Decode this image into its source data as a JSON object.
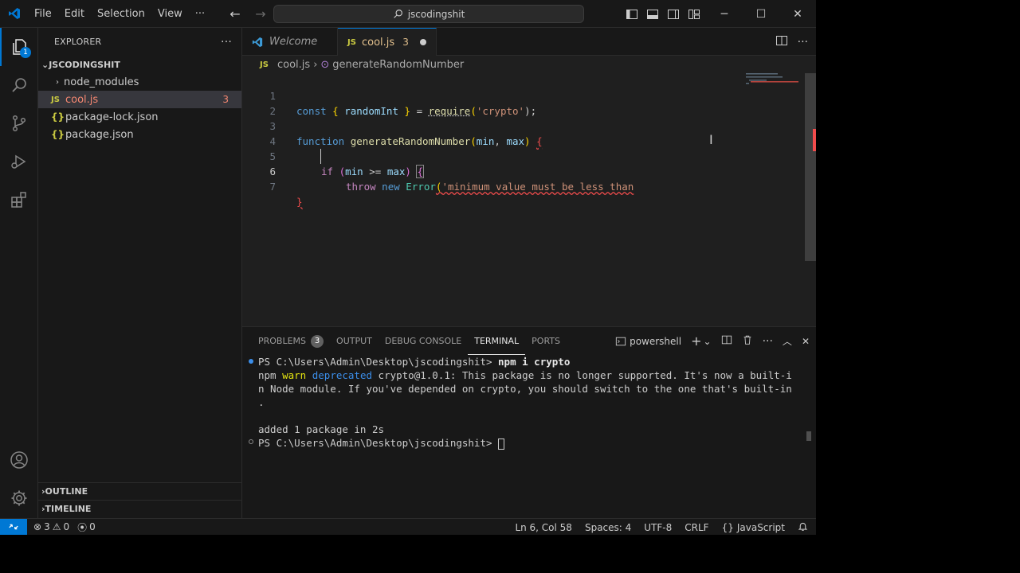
{
  "titlebar": {
    "menu": [
      "File",
      "Edit",
      "Selection",
      "View",
      "···"
    ],
    "search": "jscodingshit",
    "accent": "#0078d4"
  },
  "explorer": {
    "title": "EXPLORER",
    "folder": "JSCODINGSHIT",
    "items": [
      {
        "label": "node_modules",
        "kind": "folder"
      },
      {
        "label": "cool.js",
        "kind": "js",
        "count": "3"
      },
      {
        "label": "package-lock.json",
        "kind": "json"
      },
      {
        "label": "package.json",
        "kind": "json"
      }
    ],
    "outline": "OUTLINE",
    "timeline": "TIMELINE"
  },
  "activity": {
    "explorer_badge": "1"
  },
  "tabs": [
    {
      "label": "Welcome"
    },
    {
      "label": "cool.js",
      "count": "3"
    }
  ],
  "breadcrumb": {
    "file": "cool.js",
    "symbol": "generateRandomNumber"
  },
  "editor": {
    "line_numbers": [
      "1",
      "2",
      "3",
      "4",
      "5",
      "6",
      "7"
    ],
    "current_line": "6",
    "l1": {
      "kw": "const",
      "b_open": "{",
      "var": "randomInt",
      "b_close": "}",
      "eq": "=",
      "fn": "require",
      "p_open": "(",
      "str": "'crypto'",
      "p_close": ");"
    },
    "l3": {
      "kw": "function",
      "fn": "generateRandomNumber",
      "p_open": "(",
      "var1": "min",
      "comma": ",",
      "var2": "max",
      "p_close": ")",
      "brace": "{"
    },
    "l5": {
      "kw": "if",
      "p_open": "(",
      "var1": "min",
      "op": ">=",
      "var2": "max",
      "p_close": ")",
      "brace": "{"
    },
    "l6": {
      "kw1": "throw",
      "kw2": "new",
      "cls": "Error",
      "p_open": "(",
      "str": "'minimum value must be less than"
    },
    "l7": {
      "brace": "}"
    }
  },
  "panel": {
    "tabs": [
      "PROBLEMS",
      "OUTPUT",
      "DEBUG CONSOLE",
      "TERMINAL",
      "PORTS"
    ],
    "problems_count": "3",
    "shell": "powershell",
    "terminal": {
      "l1_prompt": "PS C:\\Users\\Admin\\Desktop\\jscodingshit>",
      "l1_cmd": "npm i crypto",
      "l2_a": "npm",
      "l2_warn": "warn",
      "l2_dep": "deprecated",
      "l2_rest": "crypto@1.0.1: This package is no longer supported. It's now a built-i",
      "l3": "n Node module. If you've depended on crypto, you should switch to the one that's built-in",
      "l4": ".",
      "l5": "added 1 package in 2s",
      "l6_prompt": "PS C:\\Users\\Admin\\Desktop\\jscodingshit>"
    }
  },
  "statusbar": {
    "errors": "3",
    "warnings": "0",
    "ports": "0",
    "position": "Ln 6, Col 58",
    "spaces": "Spaces: 4",
    "encoding": "UTF-8",
    "eol": "CRLF",
    "language": "JavaScript"
  }
}
